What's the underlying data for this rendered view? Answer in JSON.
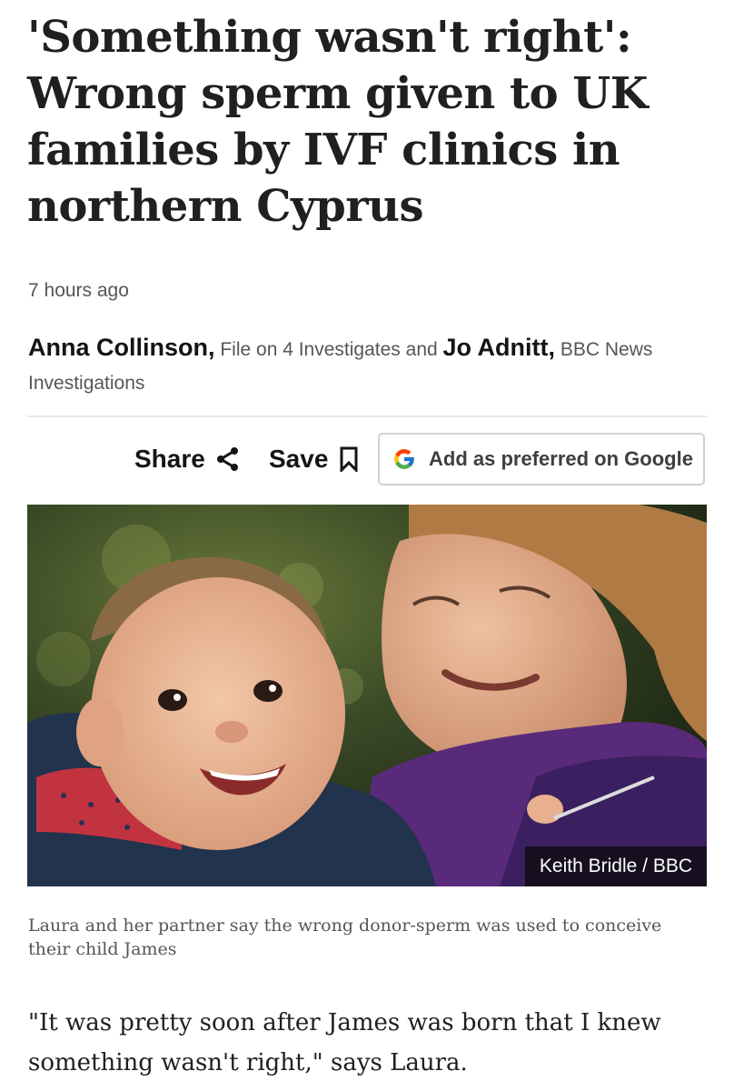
{
  "article": {
    "headline": "'Something wasn't right': Wrong sperm given to UK families by IVF clinics in northern Cyprus",
    "timestamp": "7 hours ago",
    "byline": {
      "author1": "Anna Collinson,",
      "affiliation1": "File on 4 Investigates",
      "connector": "and",
      "author2": "Jo Adnitt,",
      "affiliation2": "BBC News Investigations"
    },
    "actions": {
      "share_label": "Share",
      "save_label": "Save",
      "google_label": "Add as preferred on Google"
    },
    "image": {
      "credit": "Keith Bridle / BBC",
      "caption": "Laura and her partner say the wrong donor-sperm was used to conceive their child James"
    },
    "first_paragraph": "\"It was pretty soon after James was born that I knew something wasn't right,\" says Laura."
  },
  "icons": {
    "share": "share-icon",
    "save": "bookmark-icon",
    "google": "google-g-icon"
  },
  "colors": {
    "text": "#141414",
    "muted": "#545658",
    "divider": "#e6e8ea",
    "button_border": "#cfd2d5"
  }
}
